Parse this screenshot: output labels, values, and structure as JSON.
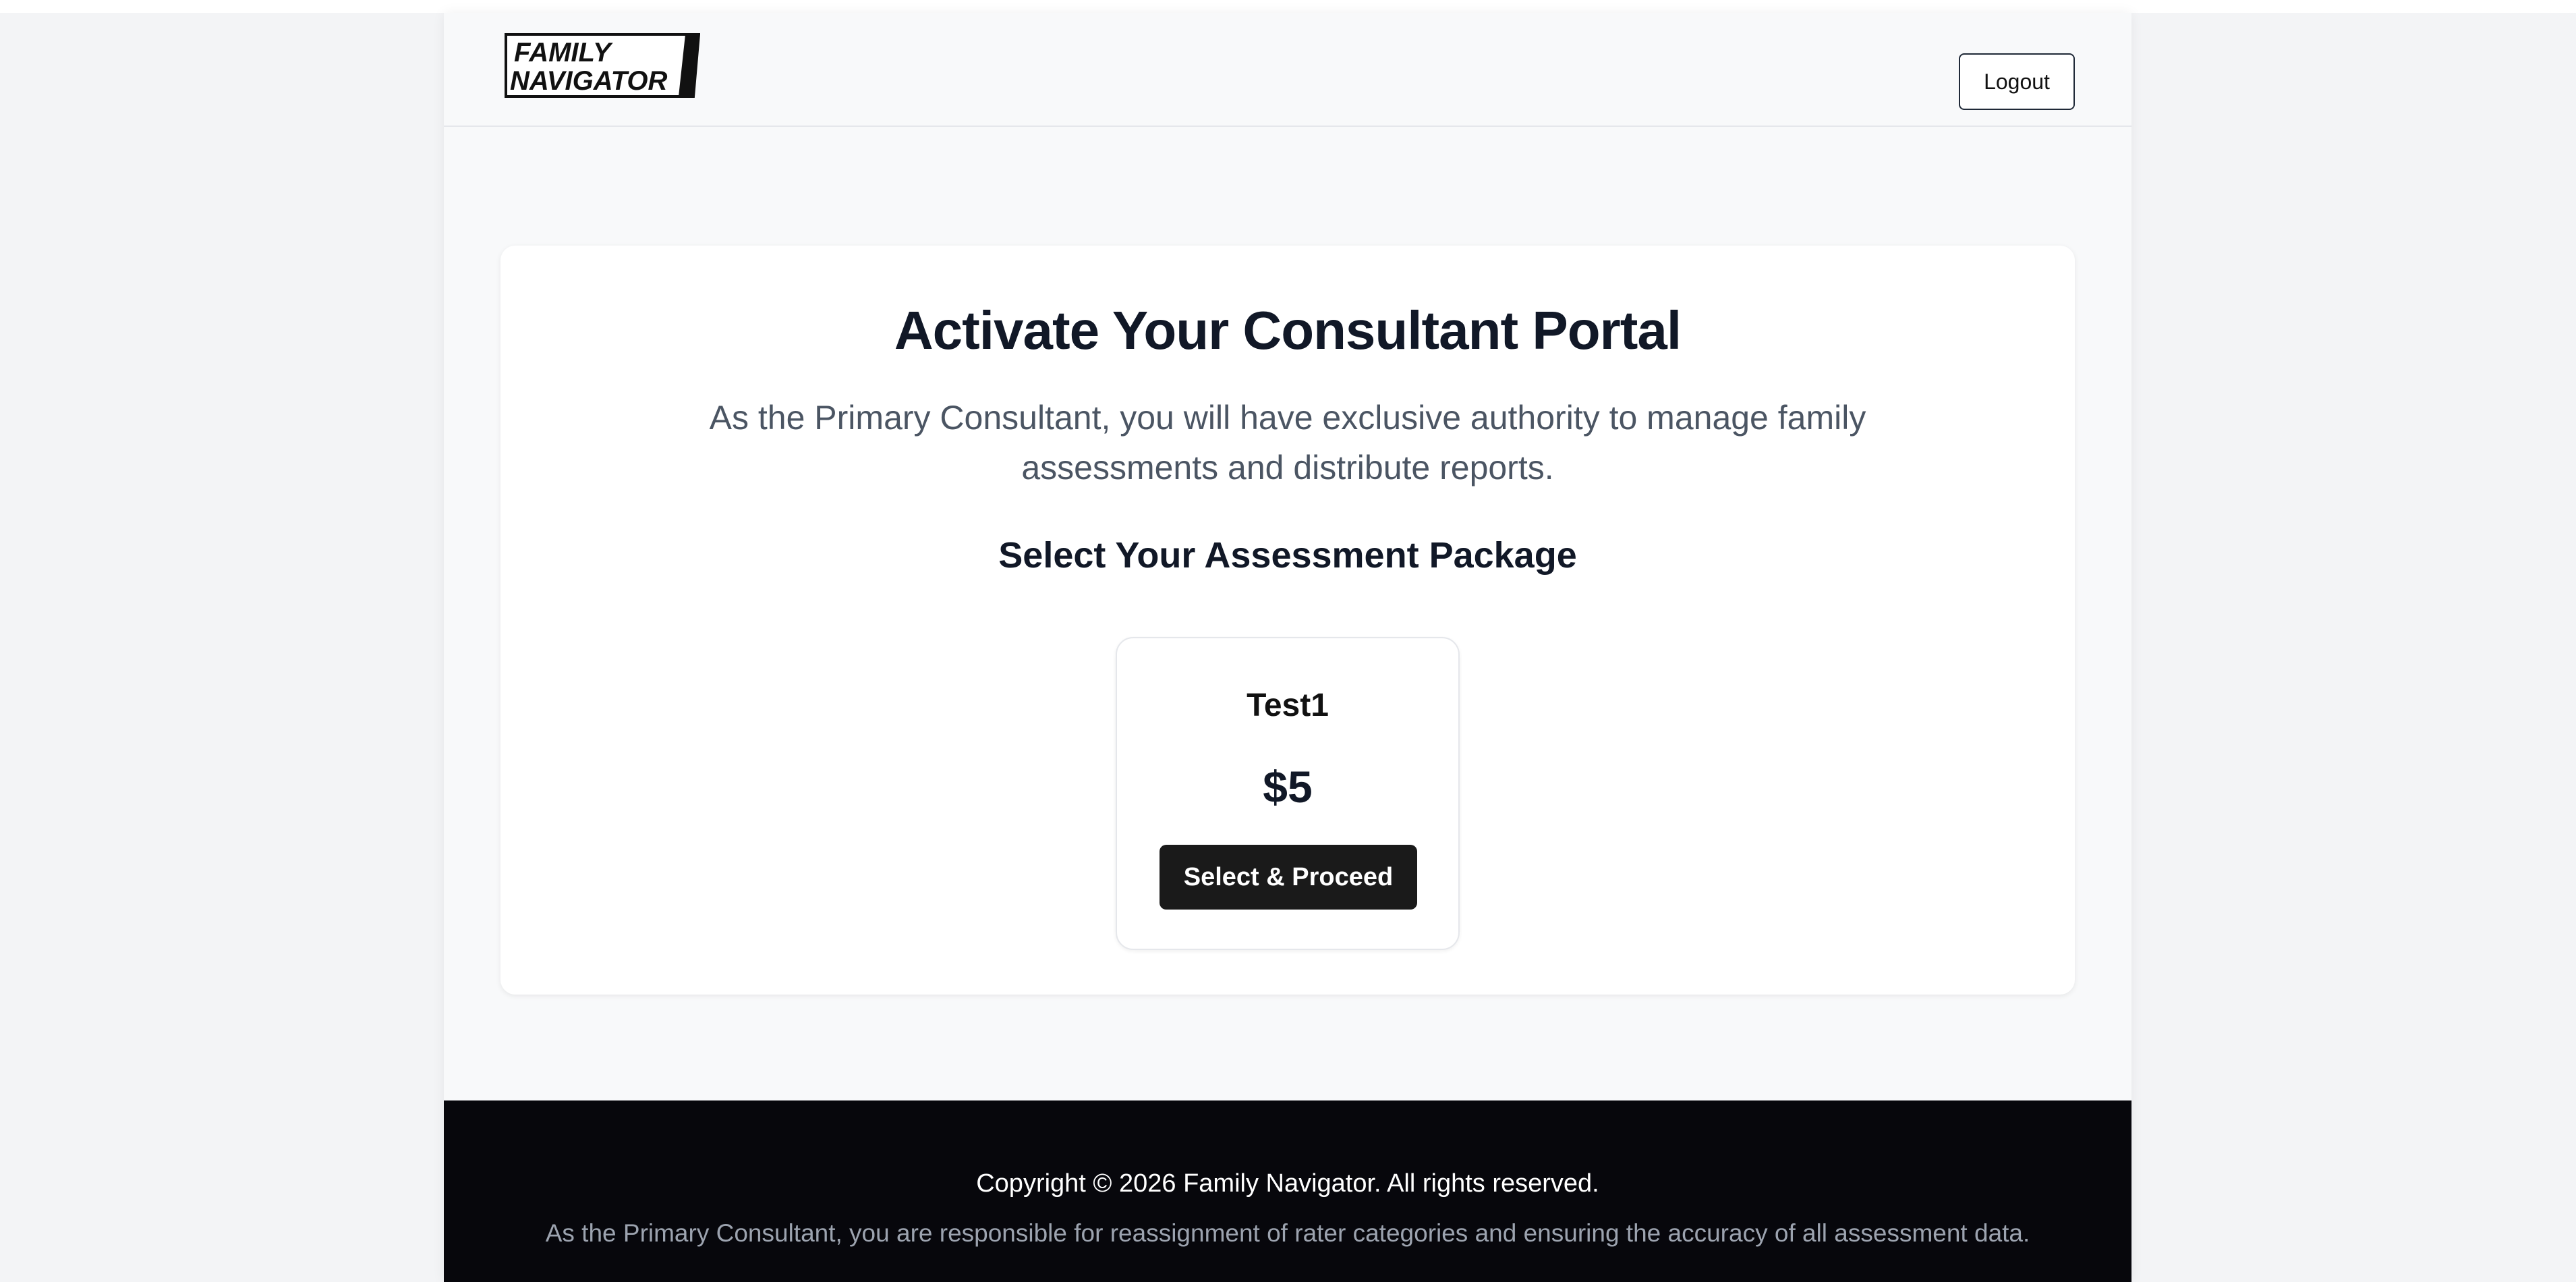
{
  "header": {
    "logo": {
      "line1": "FAMILY",
      "line2": "NAVIGATOR"
    },
    "logout_label": "Logout"
  },
  "main": {
    "title": "Activate Your Consultant Portal",
    "subtitle": "As the Primary Consultant, you will have exclusive authority to manage family assessments and distribute reports.",
    "section_title": "Select Your Assessment Package",
    "packages": [
      {
        "name": "Test1",
        "price": "$5",
        "button_label": "Select & Proceed"
      }
    ]
  },
  "footer": {
    "copyright": "Copyright © 2026 Family Navigator. All rights reserved.",
    "note": "As the Primary Consultant, you are responsible for reassignment of rater categories and ensuring the accuracy of all assessment data."
  },
  "colors": {
    "page_background": "#f3f4f6",
    "app_background": "#f8f9fa",
    "card_background": "#ffffff",
    "primary_button": "#1a1a1a",
    "footer_background": "#07070c",
    "heading_text": "#111827",
    "muted_text": "#4b5563"
  }
}
